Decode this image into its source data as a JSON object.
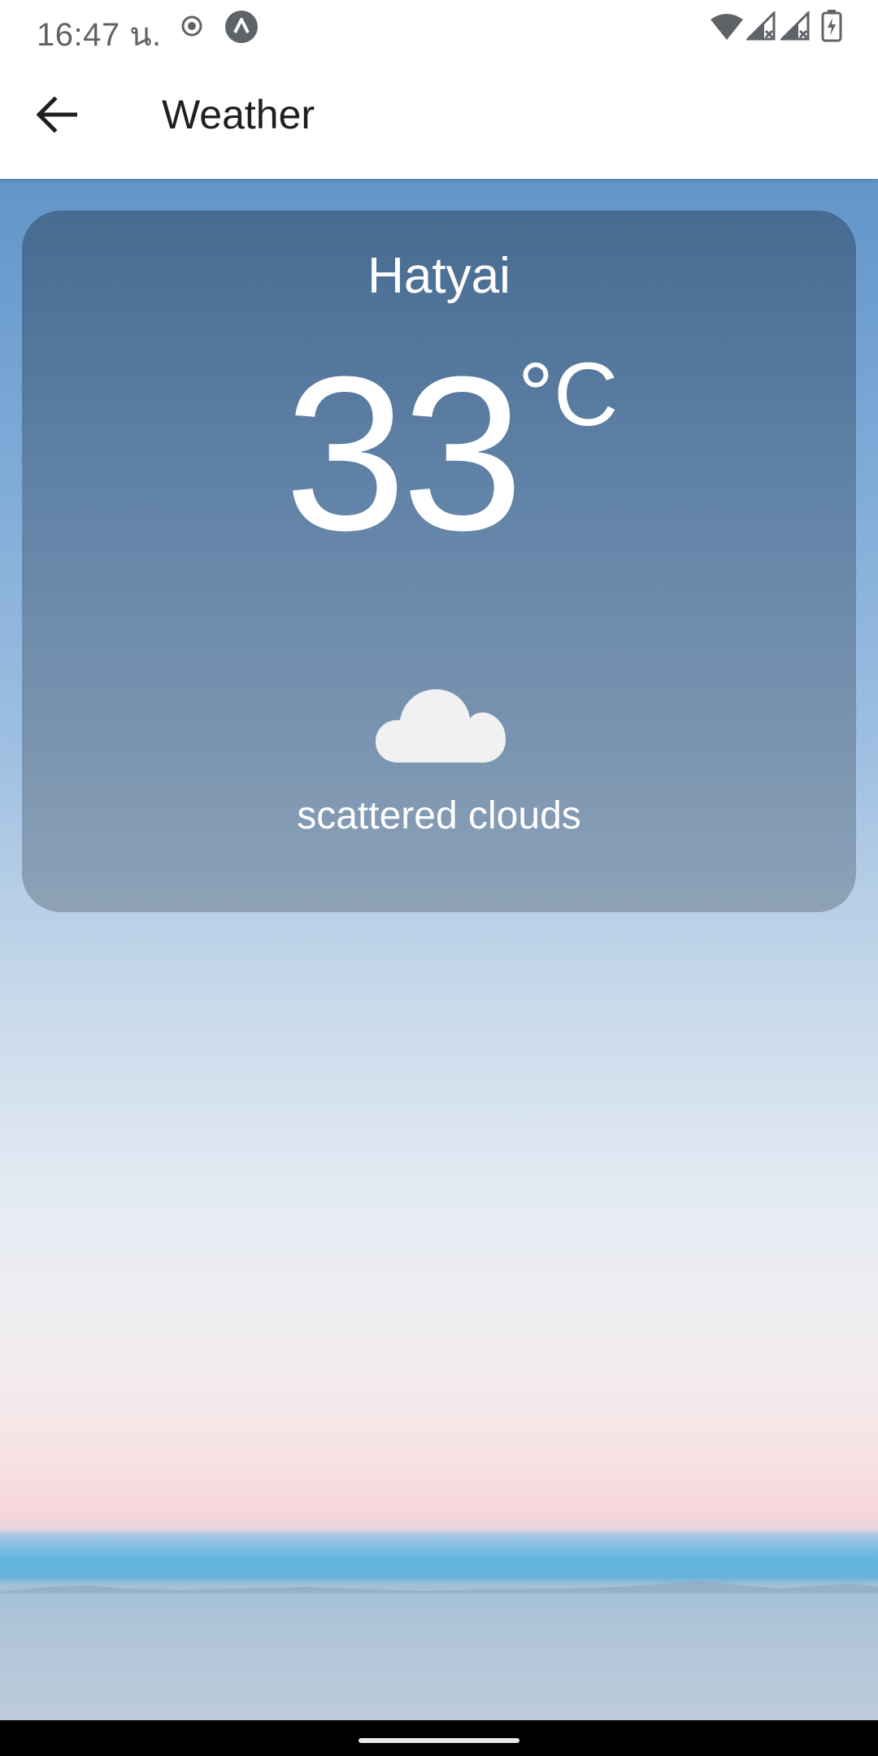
{
  "status_bar": {
    "time": "16:47 น.",
    "icons": [
      "record-icon",
      "app-a-icon",
      "wifi-icon",
      "signal-icon",
      "signal-icon-2",
      "battery-charging-icon"
    ]
  },
  "app_bar": {
    "title": "Weather",
    "back_icon": "arrow-back-icon"
  },
  "weather": {
    "city": "Hatyai",
    "temperature": "33",
    "unit": "°C",
    "condition_icon": "cloud-icon",
    "description": "scattered clouds"
  },
  "colors": {
    "card_tint": "#4e6f92",
    "text": "#ffffff",
    "app_bar_bg": "#ffffff",
    "nav_bar_bg": "#000000"
  }
}
